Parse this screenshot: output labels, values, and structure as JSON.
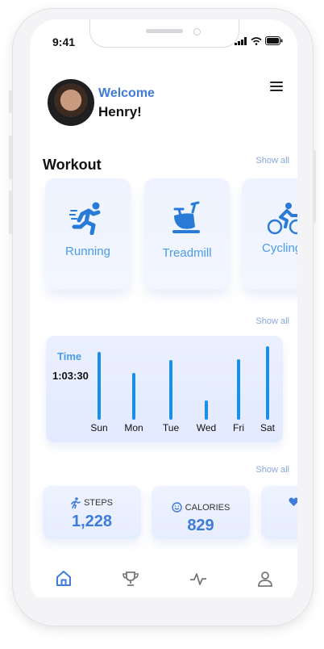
{
  "status": {
    "time": "9:41"
  },
  "user": {
    "greeting": "Welcome",
    "name": "Henry!"
  },
  "workout": {
    "title": "Workout",
    "show_all": "Show all",
    "cards": [
      {
        "label": "Running",
        "icon": "running-icon"
      },
      {
        "label": "Treadmill",
        "icon": "exercise-bike-icon"
      },
      {
        "label": "Cycling",
        "icon": "cycling-icon"
      }
    ]
  },
  "activity": {
    "show_all": "Show all",
    "label": "Time",
    "value": "1:03:30"
  },
  "chart_data": {
    "type": "bar",
    "categories": [
      "Sun",
      "Mon",
      "Tue",
      "Wed",
      "Fri",
      "Sat"
    ],
    "values": [
      88,
      60,
      77,
      25,
      78,
      95
    ],
    "ylim": [
      0,
      100
    ],
    "grid": false,
    "color": "#1a8fe8"
  },
  "stats": {
    "show_all": "Show all",
    "cards": [
      {
        "label": "STEPS",
        "value": "1,228",
        "icon": "walking-icon"
      },
      {
        "label": "CALORIES",
        "value": "829",
        "icon": "smiley-icon"
      },
      {
        "label": "",
        "value": "",
        "icon": "heart-icon"
      }
    ]
  },
  "nav": {
    "items": [
      {
        "name": "home",
        "active": true
      },
      {
        "name": "trophy",
        "active": false
      },
      {
        "name": "activity",
        "active": false
      },
      {
        "name": "profile",
        "active": false
      }
    ]
  },
  "colors": {
    "accent": "#3f7bd8",
    "bar": "#1a8fe8",
    "label": "#4a9be8"
  }
}
